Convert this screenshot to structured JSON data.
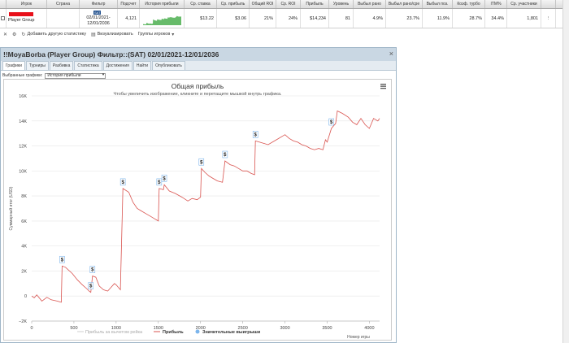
{
  "table": {
    "headers": [
      "",
      "Игрок",
      "Страна",
      "Фильтр",
      "Подсчет",
      "История прибыли",
      "Ср. ставка",
      "Ср. прибыль",
      "Общий ROI",
      "Ср. ROI",
      "Прибыль",
      "Уровень",
      "Выбыл рано",
      "Выбыл рано/сре",
      "Выбыл поз.",
      "Коэф. турбо",
      "ITM%",
      "Ср. участники",
      ""
    ],
    "row": {
      "player": "Player Group",
      "filter_badge": "SAT",
      "filter_dates": [
        "02/01/2021-",
        "12/01/2036"
      ],
      "count": "4,121",
      "avg_stake": "$13.22",
      "avg_profit": "$3.06",
      "total_roi": "21%",
      "avg_roi": "24%",
      "profit": "$14,234",
      "level": "81",
      "early": "4.9%",
      "early_mid": "23.7%",
      "late": "11.9%",
      "turbo": "28.7%",
      "itm": "34.4%",
      "avg_entrants": "1,801"
    }
  },
  "toolbar": {
    "add_stats": "Добавить другую статистику",
    "visualize": "Визуализировать",
    "groups": "Группы игроков"
  },
  "window": {
    "title": "!!MoyaBorba (Player Group) Фильтр::(SAT) 02/01/2021-12/01/2036",
    "tabs": [
      "Графики",
      "Турниры",
      "Разбивка",
      "Статистика",
      "Достижения",
      "Найти",
      "Опубликовать"
    ],
    "select_label": "Выбранные графики:",
    "select_value": "История прибыли"
  },
  "colors": {
    "profit_line": "#d9534f",
    "no_rake_line": "#cfcfcf",
    "marker": "#7cb5ec",
    "sparkline": "#4caf50"
  },
  "chart_data": {
    "type": "line",
    "title": "Общая прибыль",
    "subtitle": "Чтобы увеличить изображение, кликните и перетащите мышкой внутрь графика.",
    "ylabel": "Суммарный итог (USD)",
    "xlabel": "Номер игры",
    "xlim": [
      0,
      4121
    ],
    "ylim": [
      -2000,
      16000
    ],
    "x_ticks": [
      "0",
      "500",
      "1000",
      "1500",
      "2000",
      "2500",
      "3000",
      "3500",
      "4000"
    ],
    "y_ticks": [
      "−2K",
      "0",
      "2K",
      "4K",
      "6K",
      "8K",
      "10K",
      "12K",
      "14K",
      "16K"
    ],
    "legend": [
      "Прибыль за вычетом рейка",
      "Прибыль",
      "Значительные выигрыши"
    ],
    "legend_position": "bottom",
    "marker_label": "$",
    "series": [
      {
        "name": "Прибыль",
        "points": [
          [
            0,
            0
          ],
          [
            30,
            -150
          ],
          [
            60,
            100
          ],
          [
            120,
            -400
          ],
          [
            180,
            -100
          ],
          [
            230,
            -300
          ],
          [
            300,
            -400
          ],
          [
            350,
            -500
          ],
          [
            360,
            2400
          ],
          [
            400,
            2300
          ],
          [
            480,
            1800
          ],
          [
            540,
            1300
          ],
          [
            600,
            900
          ],
          [
            650,
            600
          ],
          [
            680,
            400
          ],
          [
            700,
            300
          ],
          [
            720,
            1600
          ],
          [
            760,
            1500
          ],
          [
            800,
            800
          ],
          [
            850,
            500
          ],
          [
            900,
            400
          ],
          [
            980,
            1000
          ],
          [
            1000,
            900
          ],
          [
            1050,
            500
          ],
          [
            1080,
            8600
          ],
          [
            1150,
            8300
          ],
          [
            1200,
            7500
          ],
          [
            1250,
            7000
          ],
          [
            1300,
            6800
          ],
          [
            1350,
            6600
          ],
          [
            1400,
            6400
          ],
          [
            1450,
            6200
          ],
          [
            1500,
            6000
          ],
          [
            1510,
            8600
          ],
          [
            1560,
            8500
          ],
          [
            1570,
            8900
          ],
          [
            1630,
            8400
          ],
          [
            1700,
            8200
          ],
          [
            1780,
            7900
          ],
          [
            1850,
            7600
          ],
          [
            1900,
            7800
          ],
          [
            1960,
            7700
          ],
          [
            2000,
            7900
          ],
          [
            2010,
            10200
          ],
          [
            2050,
            9900
          ],
          [
            2100,
            9600
          ],
          [
            2150,
            9400
          ],
          [
            2200,
            9200
          ],
          [
            2260,
            9100
          ],
          [
            2290,
            10800
          ],
          [
            2350,
            10500
          ],
          [
            2400,
            10400
          ],
          [
            2450,
            10200
          ],
          [
            2500,
            10000
          ],
          [
            2550,
            10000
          ],
          [
            2600,
            9800
          ],
          [
            2640,
            9700
          ],
          [
            2650,
            12400
          ],
          [
            2700,
            12300
          ],
          [
            2800,
            12100
          ],
          [
            2900,
            12500
          ],
          [
            3000,
            12900
          ],
          [
            3050,
            12600
          ],
          [
            3100,
            12400
          ],
          [
            3150,
            12300
          ],
          [
            3200,
            12100
          ],
          [
            3250,
            12000
          ],
          [
            3300,
            11800
          ],
          [
            3350,
            11700
          ],
          [
            3400,
            11800
          ],
          [
            3450,
            11700
          ],
          [
            3480,
            12500
          ],
          [
            3500,
            12300
          ],
          [
            3550,
            13400
          ],
          [
            3600,
            13800
          ],
          [
            3620,
            14800
          ],
          [
            3680,
            14600
          ],
          [
            3750,
            14300
          ],
          [
            3800,
            13900
          ],
          [
            3850,
            13700
          ],
          [
            3900,
            14200
          ],
          [
            3950,
            13700
          ],
          [
            4000,
            13400
          ],
          [
            4050,
            14200
          ],
          [
            4100,
            14000
          ],
          [
            4121,
            14200
          ]
        ]
      },
      {
        "name": "Значительные выигрыши",
        "points": [
          [
            360,
            2400
          ],
          [
            700,
            300
          ],
          [
            720,
            1600
          ],
          [
            1080,
            8600
          ],
          [
            1510,
            8600
          ],
          [
            1570,
            8900
          ],
          [
            2010,
            10200
          ],
          [
            2290,
            10800
          ],
          [
            2650,
            12400
          ],
          [
            3550,
            13400
          ]
        ]
      }
    ]
  }
}
